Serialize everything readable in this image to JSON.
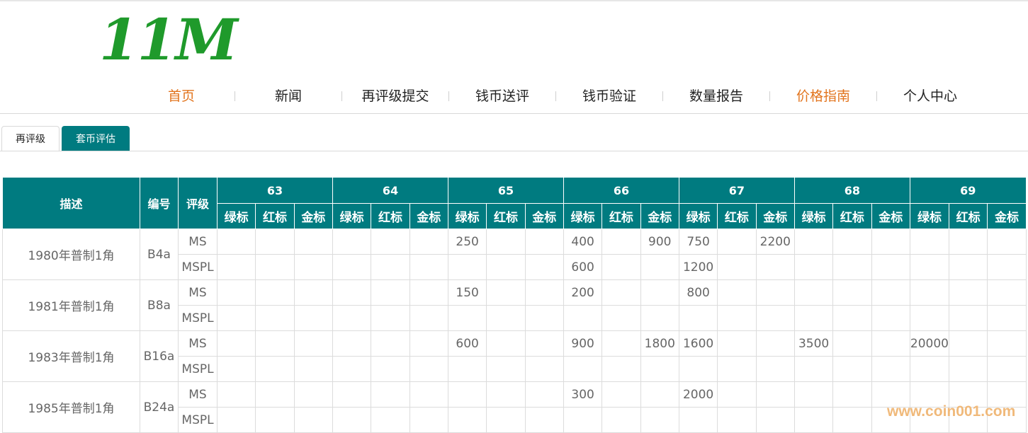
{
  "logo": "11M",
  "nav": [
    {
      "label": "首页",
      "active": true
    },
    {
      "label": "新闻",
      "active": false
    },
    {
      "label": "再评级提交",
      "active": false
    },
    {
      "label": "钱币送评",
      "active": false
    },
    {
      "label": "钱币验证",
      "active": false
    },
    {
      "label": "数量报告",
      "active": false
    },
    {
      "label": "价格指南",
      "active": true
    },
    {
      "label": "个人中心",
      "active": false
    }
  ],
  "tabs": [
    {
      "label": "再评级",
      "teal": false
    },
    {
      "label": "套币评估",
      "teal": true
    }
  ],
  "table": {
    "col_desc": "描述",
    "col_code": "编号",
    "col_grade": "评级",
    "grades": [
      "63",
      "64",
      "65",
      "66",
      "67",
      "68",
      "69"
    ],
    "labels": [
      "绿标",
      "红标",
      "金标"
    ],
    "rows": [
      {
        "desc": "1980年普制1角",
        "code": "B4a",
        "lines": [
          {
            "grade": "MS",
            "values": [
              "",
              "",
              "",
              "",
              "",
              "",
              "250",
              "",
              "",
              "400",
              "",
              "900",
              "750",
              "",
              "2200",
              "",
              "",
              "",
              "",
              "",
              ""
            ]
          },
          {
            "grade": "MSPL",
            "values": [
              "",
              "",
              "",
              "",
              "",
              "",
              "",
              "",
              "",
              "600",
              "",
              "",
              "1200",
              "",
              "",
              "",
              "",
              "",
              "",
              "",
              ""
            ]
          }
        ]
      },
      {
        "desc": "1981年普制1角",
        "code": "B8a",
        "lines": [
          {
            "grade": "MS",
            "values": [
              "",
              "",
              "",
              "",
              "",
              "",
              "150",
              "",
              "",
              "200",
              "",
              "",
              "800",
              "",
              "",
              "",
              "",
              "",
              "",
              "",
              ""
            ]
          },
          {
            "grade": "MSPL",
            "values": [
              "",
              "",
              "",
              "",
              "",
              "",
              "",
              "",
              "",
              "",
              "",
              "",
              "",
              "",
              "",
              "",
              "",
              "",
              "",
              "",
              ""
            ]
          }
        ]
      },
      {
        "desc": "1983年普制1角",
        "code": "B16a",
        "lines": [
          {
            "grade": "MS",
            "values": [
              "",
              "",
              "",
              "",
              "",
              "",
              "600",
              "",
              "",
              "900",
              "",
              "1800",
              "1600",
              "",
              "",
              "3500",
              "",
              "",
              "20000",
              "",
              ""
            ]
          },
          {
            "grade": "MSPL",
            "values": [
              "",
              "",
              "",
              "",
              "",
              "",
              "",
              "",
              "",
              "",
              "",
              "",
              "",
              "",
              "",
              "",
              "",
              "",
              "",
              "",
              ""
            ]
          }
        ]
      },
      {
        "desc": "1985年普制1角",
        "code": "B24a",
        "lines": [
          {
            "grade": "MS",
            "values": [
              "",
              "",
              "",
              "",
              "",
              "",
              "",
              "",
              "",
              "300",
              "",
              "",
              "2000",
              "",
              "",
              "",
              "",
              "",
              "",
              "",
              ""
            ]
          },
          {
            "grade": "MSPL",
            "values": [
              "",
              "",
              "",
              "",
              "",
              "",
              "",
              "",
              "",
              "",
              "",
              "",
              "",
              "",
              "",
              "",
              "",
              "",
              "",
              "",
              ""
            ]
          }
        ]
      }
    ]
  },
  "watermark": "www.coin001.com"
}
